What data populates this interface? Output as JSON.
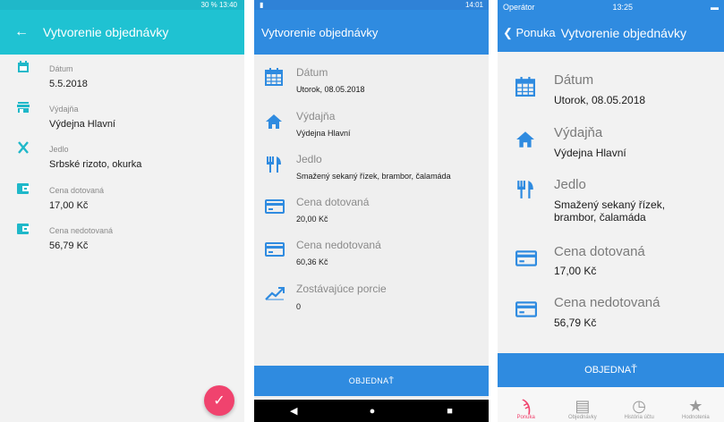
{
  "panel1": {
    "status": "30 % 13:40",
    "title": "Vytvorenie objednávky",
    "fields": [
      {
        "label": "Dátum",
        "value": "5.5.2018"
      },
      {
        "label": "Výdajňa",
        "value": "Výdejna Hlavní"
      },
      {
        "label": "Jedlo",
        "value": "Srbské rizoto, okurka"
      },
      {
        "label": "Cena dotovaná",
        "value": "17,00 Kč"
      },
      {
        "label": "Cena nedotovaná",
        "value": "56,79 Kč"
      }
    ],
    "fab_icon": "✓",
    "accent": "#1fc2d2",
    "fab_color": "#f0436e"
  },
  "panel2": {
    "status_time": "14:01",
    "title": "Vytvorenie objednávky",
    "fields": [
      {
        "label": "Dátum",
        "value": "Utorok, 08.05.2018"
      },
      {
        "label": "Výdajňa",
        "value": "Výdejna Hlavní"
      },
      {
        "label": "Jedlo",
        "value": "Smažený sekaný řízek, brambor, čalamáda"
      },
      {
        "label": "Cena dotovaná",
        "value": "20,00 Kč"
      },
      {
        "label": "Cena nedotovaná",
        "value": "60,36 Kč"
      },
      {
        "label": "Zostávajúce porcie",
        "value": "0"
      }
    ],
    "order_label": "OBJEDNAŤ",
    "accent": "#2f8be0"
  },
  "panel3": {
    "carrier": "Operátor",
    "time": "13:25",
    "back_label": "Ponuka",
    "title": "Vytvorenie objednávky",
    "fields": [
      {
        "label": "Dátum",
        "value": "Utorok, 08.05.2018"
      },
      {
        "label": "Výdajňa",
        "value": "Výdejna Hlavní"
      },
      {
        "label": "Jedlo",
        "value": "Smažený sekaný řízek, brambor, čalamáda"
      },
      {
        "label": "Cena dotovaná",
        "value": "17,00 Kč"
      },
      {
        "label": "Cena nedotovaná",
        "value": "56,79 Kč"
      }
    ],
    "order_label": "OBJEDNAŤ",
    "tabs": [
      {
        "label": "Ponuka",
        "icon": "cutlery-icon"
      },
      {
        "label": "Objednávky",
        "icon": "document-icon"
      },
      {
        "label": "História účtu",
        "icon": "clock-icon"
      },
      {
        "label": "Hodnotenia",
        "icon": "star-icon"
      }
    ]
  }
}
